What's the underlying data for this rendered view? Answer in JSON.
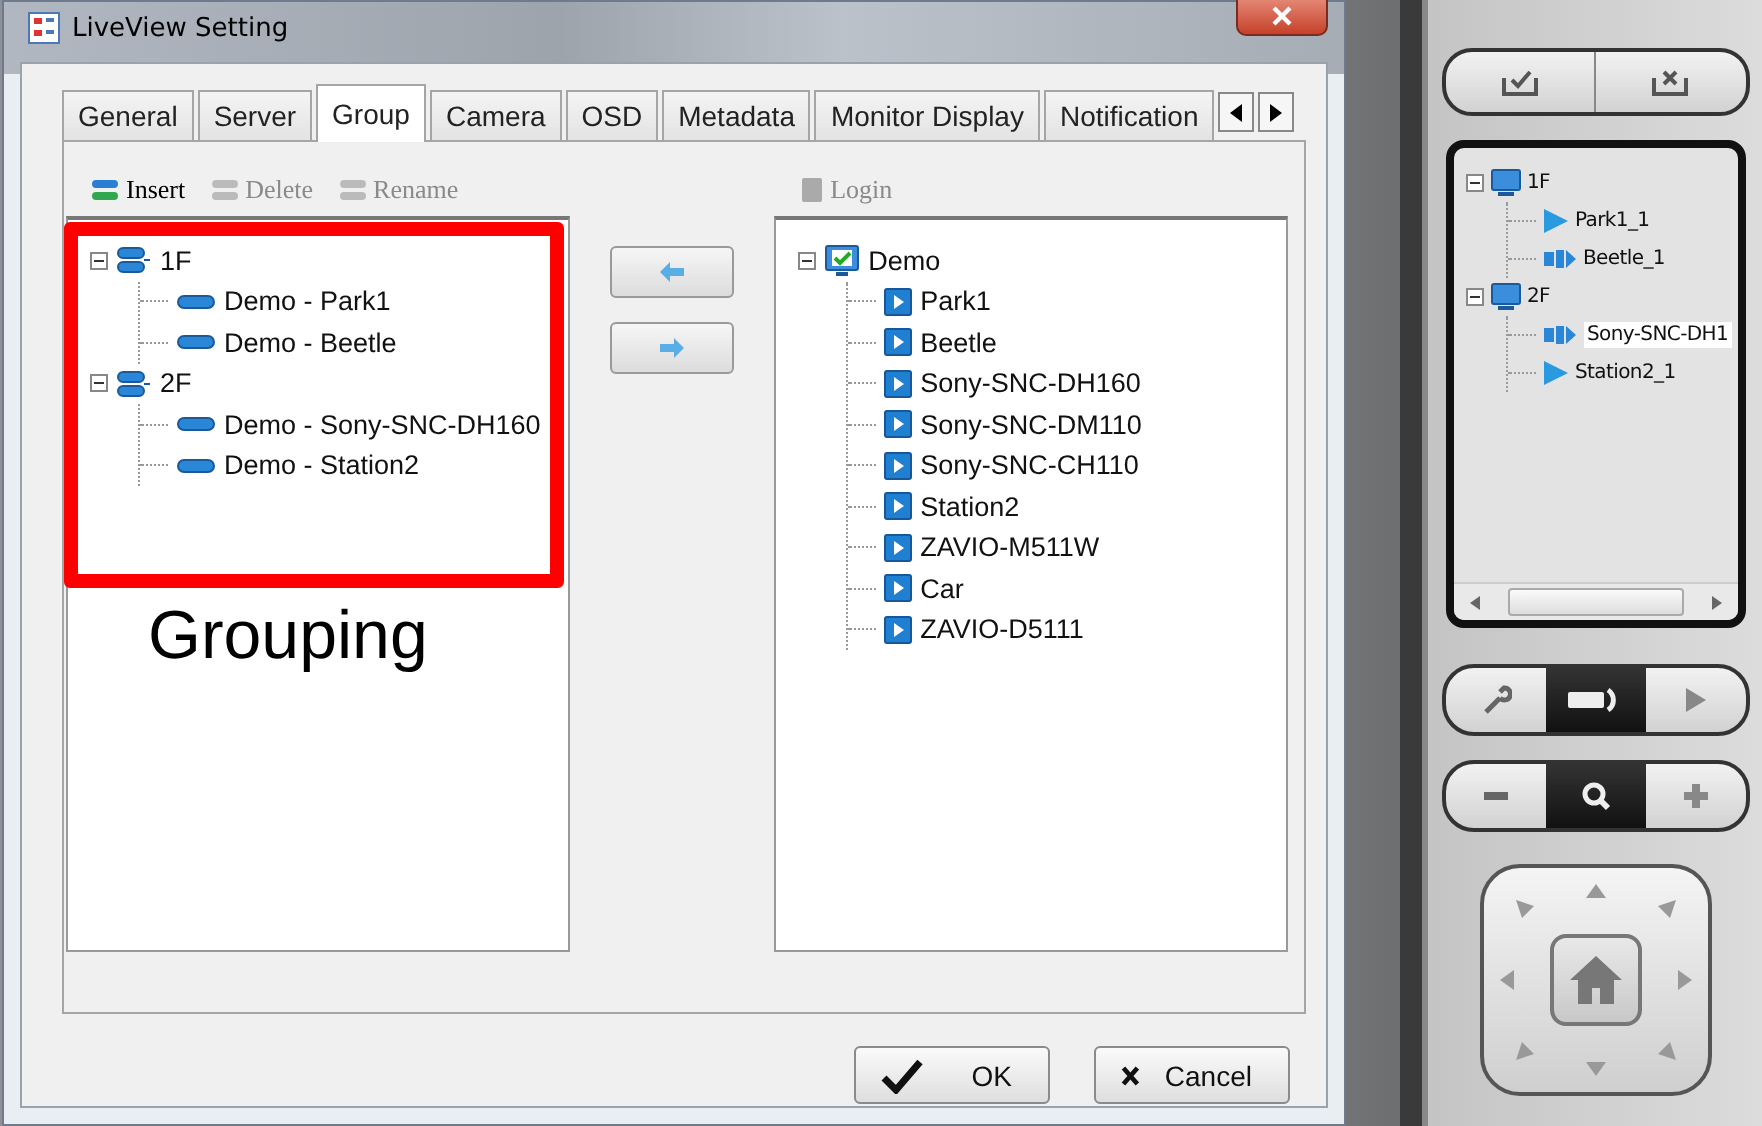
{
  "window": {
    "title": "LiveView Setting"
  },
  "tabs": [
    {
      "label": "General",
      "selected": false
    },
    {
      "label": "Server",
      "selected": false
    },
    {
      "label": "Group",
      "selected": true
    },
    {
      "label": "Camera",
      "selected": false
    },
    {
      "label": "OSD",
      "selected": false
    },
    {
      "label": "Metadata",
      "selected": false
    },
    {
      "label": "Monitor Display",
      "selected": false
    },
    {
      "label": "Notification",
      "selected": false
    }
  ],
  "group_toolbar": [
    {
      "label": "Insert",
      "disabled": false
    },
    {
      "label": "Delete",
      "disabled": true
    },
    {
      "label": "Rename",
      "disabled": true
    }
  ],
  "camera_toolbar": [
    {
      "label": "Login",
      "disabled": true
    }
  ],
  "group_tree": [
    {
      "label": "1F",
      "expanded": true,
      "children": [
        {
          "label": "Demo - Park1"
        },
        {
          "label": "Demo - Beetle"
        }
      ]
    },
    {
      "label": "2F",
      "expanded": true,
      "children": [
        {
          "label": "Demo - Sony-SNC-DH160"
        },
        {
          "label": "Demo - Station2"
        }
      ]
    }
  ],
  "camera_tree": [
    {
      "label": "Demo",
      "expanded": true,
      "children": [
        {
          "label": "Park1"
        },
        {
          "label": "Beetle"
        },
        {
          "label": "Sony-SNC-DH160"
        },
        {
          "label": "Sony-SNC-DM110"
        },
        {
          "label": "Sony-SNC-CH110"
        },
        {
          "label": "Station2"
        },
        {
          "label": "ZAVIO-M511W"
        },
        {
          "label": "Car"
        },
        {
          "label": "ZAVIO-D5111"
        }
      ]
    }
  ],
  "annotation": {
    "label": "Grouping"
  },
  "buttons": [
    {
      "label": "OK",
      "kind": "ok"
    },
    {
      "label": "Cancel",
      "kind": "cancel"
    }
  ],
  "side_tree": [
    {
      "label": "1F",
      "expanded": true,
      "children": [
        {
          "label": "Park1_1",
          "kind": "video",
          "selected": false
        },
        {
          "label": "Beetle_1",
          "kind": "audio",
          "selected": false
        }
      ]
    },
    {
      "label": "2F",
      "expanded": true,
      "children": [
        {
          "label": "Sony-SNC-DH1",
          "kind": "audio",
          "selected": true
        },
        {
          "label": "Station2_1",
          "kind": "video",
          "selected": false
        }
      ]
    }
  ]
}
